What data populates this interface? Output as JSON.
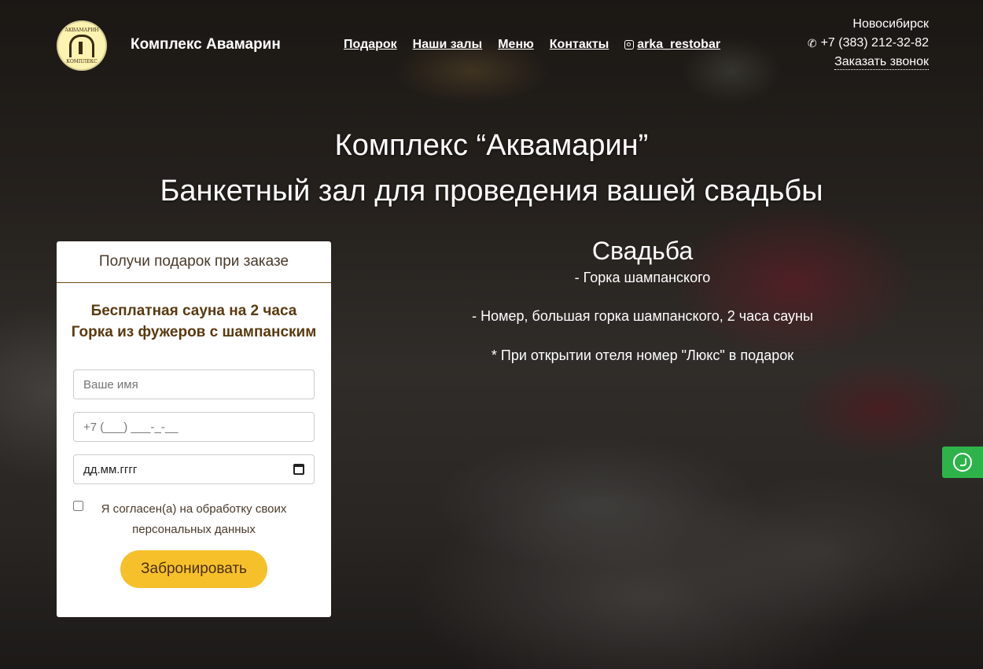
{
  "header": {
    "logo_top": "АКВАМАРИН",
    "logo_bottom": "КОМПЛЕКС",
    "brand": "Комплекс Авамарин",
    "nav": [
      "Подарок",
      "Наши залы",
      "Меню",
      "Контакты"
    ],
    "instagram": "arka_restobar",
    "city": "Новосибирск",
    "phone": "+7 (383) 212-32-82",
    "callback": "Заказать звонок"
  },
  "hero": {
    "line1": "Комплекс “Аквамарин”",
    "line2": "Банкетный зал для проведения вашей свадьбы"
  },
  "form": {
    "title": "Получи подарок при заказе",
    "gift1": "Бесплатная сауна на 2 часа",
    "gift2": "Горка из фужеров с шампанским",
    "name_placeholder": "Ваше имя",
    "phone_placeholder": "+7 (___) ___-_-__",
    "date_placeholder": "дд.мм.гггг",
    "agree": "Я согласен(а) на обработку своих персональных данных",
    "submit": "Забронировать"
  },
  "offer": {
    "title": "Свадьба",
    "item1": "- Горка шампанского",
    "item2": "- Номер, большая горка шампанского, 2 часа сауны",
    "note": "* При открытии отеля номер \"Люкс\" в подарок"
  },
  "colors": {
    "accent": "#f6c02b",
    "whatsapp": "#2eb34a",
    "brown": "#5a3a10"
  },
  "icons": {
    "phone": "phone-icon",
    "instagram": "instagram-icon",
    "whatsapp": "whatsapp-icon",
    "calendar": "calendar-icon"
  }
}
